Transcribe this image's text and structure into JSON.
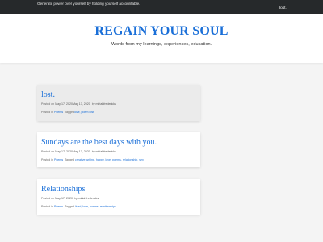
{
  "topbar": {
    "tagline": "Generate power over yourself by holding yourself accountable.",
    "link": "lost."
  },
  "header": {
    "title": "REGAIN YOUR SOUL",
    "description": "Words from my learnings, experiences, education."
  },
  "posts": [
    {
      "title": "lost.",
      "posted_on_label": "Posted on",
      "date": "May 17, 2020May 17, 2020",
      "by_label": "by",
      "author": "miriahfredericks",
      "posted_in_label": "Posted in",
      "category": "Poems",
      "tagged_label": "Tagged",
      "tags": "love, poem lost"
    },
    {
      "title": "Sundays are the best days with you.",
      "posted_on_label": "Posted on",
      "date": "May 17, 2020May 17, 2020",
      "by_label": "by",
      "author": "miriahfredericks",
      "posted_in_label": "Posted in",
      "category": "Poems",
      "tagged_label": "Tagged",
      "tags": "creative writing, happy, love, poems, relationship, sex"
    },
    {
      "title": "Relationships",
      "posted_on_label": "Posted on",
      "date": "May 17, 2020",
      "by_label": "by",
      "author": "miriahfredericks",
      "posted_in_label": "Posted in",
      "category": "Poems",
      "tagged_label": "Tagged",
      "tags": "lived, love, poems, relationships"
    }
  ],
  "colors": {
    "accent": "#1a6fd8",
    "topbar": "#26292b",
    "background": "#f4f4f4"
  }
}
